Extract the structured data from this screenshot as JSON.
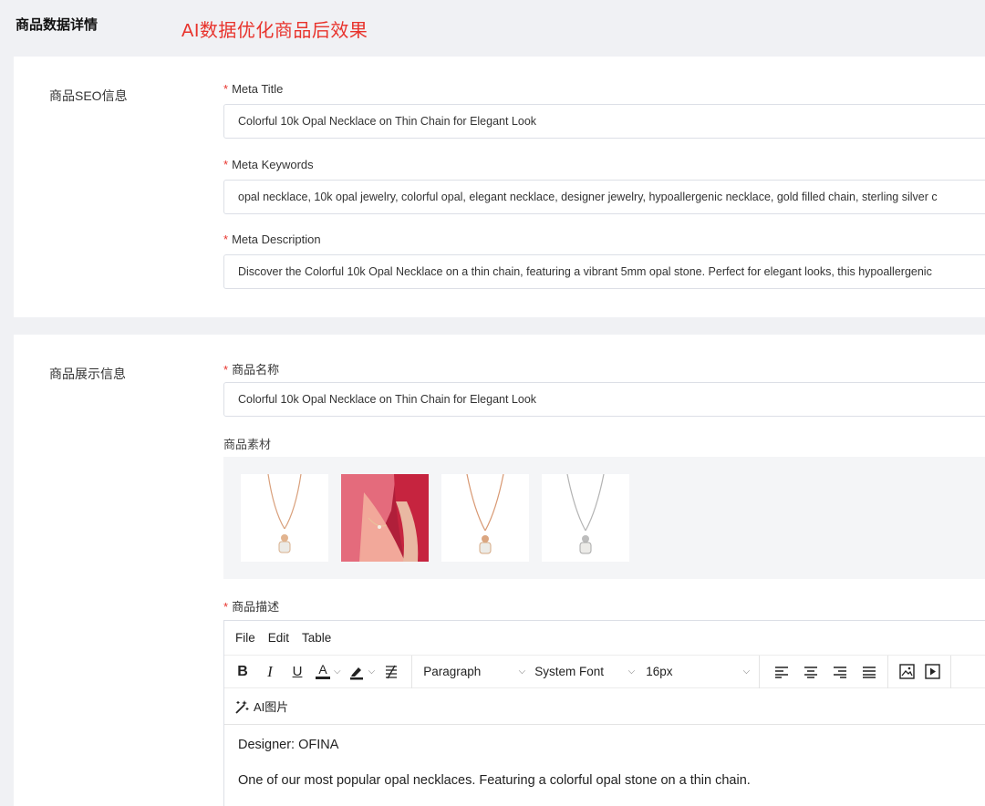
{
  "header": {
    "title": "商品数据详情",
    "subtitle": "AI数据优化商品后效果"
  },
  "seo": {
    "section_label": "商品SEO信息",
    "meta_title": {
      "label": "Meta Title",
      "value": "Colorful 10k Opal Necklace on Thin Chain for Elegant Look"
    },
    "meta_keywords": {
      "label": "Meta Keywords",
      "value": "opal necklace, 10k opal jewelry, colorful opal, elegant necklace, designer jewelry, hypoallergenic necklace, gold filled chain, sterling silver c"
    },
    "meta_description": {
      "label": "Meta Description",
      "value": "Discover the Colorful 10k Opal Necklace on a thin chain, featuring a vibrant 5mm opal stone. Perfect for elegant looks, this hypoallergenic"
    }
  },
  "display": {
    "section_label": "商品展示信息",
    "product_name": {
      "label": "商品名称",
      "value": "Colorful 10k Opal Necklace on Thin Chain for Elegant Look"
    },
    "media": {
      "label": "商品素材",
      "images": [
        "rose-gold-necklace-image",
        "model-wearing-necklace-image",
        "gold-necklace-image",
        "silver-necklace-image"
      ]
    },
    "description": {
      "label": "商品描述",
      "menu": [
        "File",
        "Edit",
        "Table"
      ],
      "toolbar": {
        "bold": "B",
        "italic": "I",
        "underline": "U",
        "font_color": "A",
        "block_format": "Paragraph",
        "font_family": "System Font",
        "font_size": "16px"
      },
      "ai_image_button": "AI图片",
      "content": [
        "Designer: OFINA",
        "One of our most popular opal necklaces. Featuring a colorful opal stone on a thin chain."
      ]
    }
  },
  "colors": {
    "accent_red": "#e8332c",
    "page_bg": "#f0f1f4",
    "media_bg": "#f4f5f7",
    "border": "#dcdfe6"
  }
}
